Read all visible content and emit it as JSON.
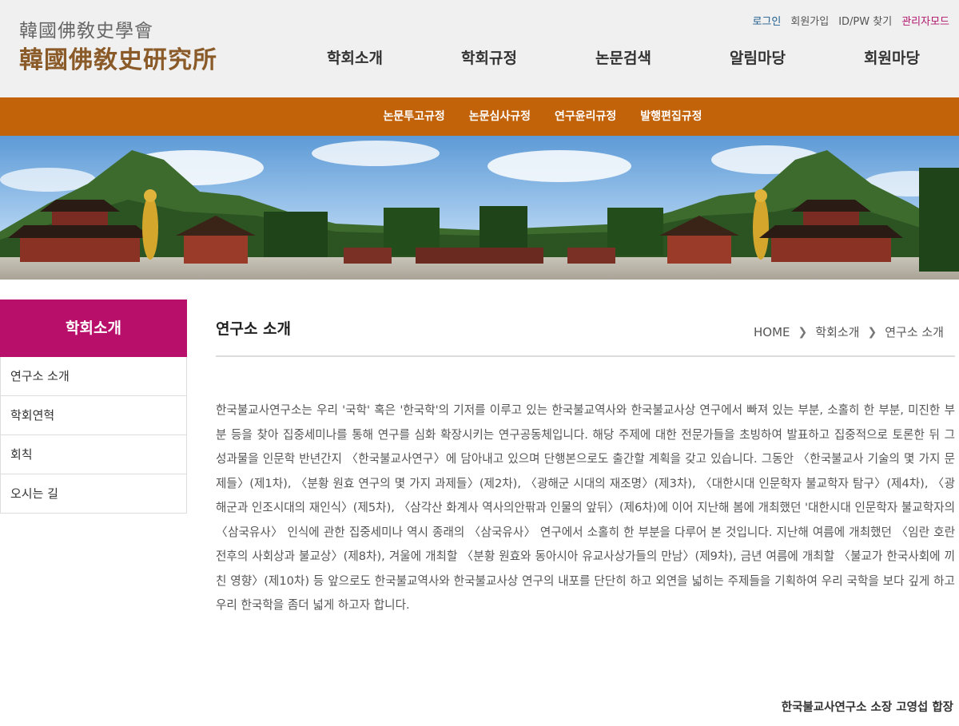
{
  "header": {
    "logo_small": "韓國佛敎史學會",
    "logo_big": "韓國佛敎史研究所",
    "util": {
      "login": "로그인",
      "join": "회원가입",
      "find": "ID/PW 찾기",
      "admin": "관리자모드"
    },
    "gnb": [
      "학회소개",
      "학회규정",
      "논문검색",
      "알림마당",
      "회원마당"
    ]
  },
  "subnav": [
    "논문투고규정",
    "논문심사규정",
    "연구윤리규정",
    "발행편집규정"
  ],
  "sidebar": {
    "title": "학회소개",
    "items": [
      "연구소 소개",
      "학회연혁",
      "회칙",
      "오시는 길"
    ]
  },
  "content": {
    "title": "연구소 소개",
    "breadcrumb": [
      "HOME",
      "학회소개",
      "연구소 소개"
    ],
    "body": "한국불교사연구소는 우리 '국학' 혹은 '한국학'의 기저를 이루고 있는 한국불교역사와 한국불교사상 연구에서 빠져 있는 부분, 소홀히 한 부분, 미진한 부분 등을 찾아 집중세미나를 통해 연구를 심화 확장시키는 연구공동체입니다. 해당 주제에 대한 전문가들을 초빙하여 발표하고 집중적으로 토론한 뒤 그 성과물을 인문학 반년간지 〈한국불교사연구〉에 담아내고 있으며 단행본으로도 출간할 계획을 갖고 있습니다. 그동안 〈한국불교사 기술의 몇 가지 문제들〉(제1차), 〈분황 원효 연구의 몇 가지 과제들〉(제2차), 〈광해군 시대의 재조명〉(제3차), 〈대한시대 인문학자 불교학자 탐구〉(제4차), 〈광해군과 인조시대의 재인식〉(제5차), 〈삼각산 화계사 역사의안팎과 인물의 앞뒤〉(제6차)에 이어 지난해 봄에 개최했던 '대한시대 인문학자 불교학자의 〈삼국유사〉 인식에 관한 집중세미나 역시 종래의 〈삼국유사〉 연구에서 소홀히 한 부분을 다루어 본 것입니다. 지난해 여름에 개최했던 〈임란 호란 전후의 사회상과 불교상〉(제8차), 겨울에 개최할 〈분황 원효와 동아시아 유교사상가들의 만남〉(제9차), 금년 여름에 개최할 〈불교가 한국사회에 끼친 영향〉(제10차) 등 앞으로도 한국불교역사와 한국불교사상 연구의 내포를 단단히 하고 외연을 넓히는 주제들을 기획하여 우리 국학을 보다 깊게 하고 우리 한국학을 좀더 넓게 하고자 합니다.",
    "signature": "한국불교사연구소 소장 고영섭 합장"
  },
  "colors": {
    "subnav_bg": "#c26209",
    "sidebar_title_bg": "#b80f6a",
    "logo_brown": "#8a5a28",
    "admin_link": "#b0166b",
    "login_link": "#1e5c8c"
  }
}
